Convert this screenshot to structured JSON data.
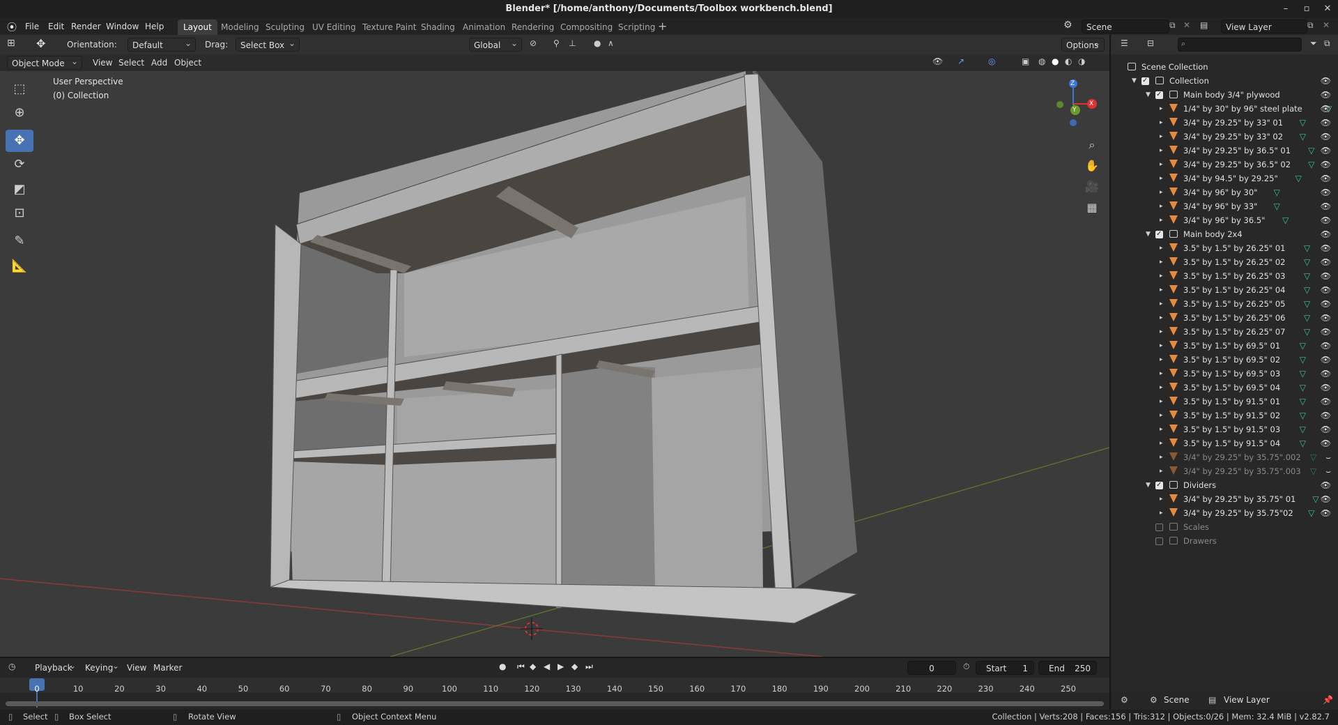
{
  "window": {
    "title": "Blender* [/home/anthony/Documents/Toolbox workbench.blend]",
    "controls": [
      "–",
      "▫",
      "✕"
    ]
  },
  "menu": [
    "File",
    "Edit",
    "Render",
    "Window",
    "Help"
  ],
  "workspaces": [
    "Layout",
    "Modeling",
    "Sculpting",
    "UV Editing",
    "Texture Paint",
    "Shading",
    "Animation",
    "Rendering",
    "Compositing",
    "Scripting"
  ],
  "active_workspace": "Layout",
  "scene_field": "Scene",
  "view_layer_field": "View Layer",
  "tool_header": {
    "orientation_label": "Orientation:",
    "orientation_value": "Default",
    "drag_label": "Drag:",
    "drag_value": "Select Box",
    "transform_orientation": "Global",
    "options": "Options"
  },
  "viewport_header": {
    "mode": "Object Mode",
    "menus": [
      "View",
      "Select",
      "Add",
      "Object"
    ]
  },
  "viewport_overlay_text": {
    "perspective": "User Perspective",
    "collection": "(0) Collection"
  },
  "gizmo": {
    "x": "X",
    "y": "Y",
    "z": "Z"
  },
  "outliner": {
    "root": "Scene Collection",
    "collection": "Collection",
    "groups": [
      {
        "name": "Main body 3/4\" plywood",
        "items": [
          "1/4\" by 30\" by 96\" steel plate",
          "3/4\" by 29.25\" by 33\" 01",
          "3/4\" by 29.25\" by 33\" 02",
          "3/4\" by 29.25\" by 36.5\" 01",
          "3/4\" by 29.25\" by 36.5\" 02",
          "3/4\" by 94.5\" by 29.25\"",
          "3/4\" by 96\" by 30\"",
          "3/4\" by 96\" by 33\"",
          "3/4\" by 96\" by 36.5\""
        ]
      },
      {
        "name": "Main body 2x4",
        "items": [
          "3.5\" by 1.5\" by 26.25\" 01",
          "3.5\" by 1.5\" by 26.25\" 02",
          "3.5\" by 1.5\" by 26.25\" 03",
          "3.5\" by 1.5\" by 26.25\" 04",
          "3.5\" by 1.5\" by 26.25\" 05",
          "3.5\" by 1.5\" by 26.25\" 06",
          "3.5\" by 1.5\" by 26.25\" 07",
          "3.5\" by 1.5\" by 69.5\" 01",
          "3.5\" by 1.5\" by 69.5\" 02",
          "3.5\" by 1.5\" by 69.5\" 03",
          "3.5\" by 1.5\" by 69.5\" 04",
          "3.5\" by 1.5\" by 91.5\" 01",
          "3.5\" by 1.5\" by 91.5\" 02",
          "3.5\" by 1.5\" by 91.5\" 03",
          "3.5\" by 1.5\" by 91.5\" 04"
        ],
        "hidden_items": [
          "3/4\" by 29.25\" by 35.75\".002",
          "3/4\" by 29.25\" by 35.75\".003"
        ]
      },
      {
        "name": "Dividers",
        "items": [
          "3/4\" by 29.25\" by 35.75\" 01",
          "3/4\" by 29.25\" by 35.75\"02"
        ]
      }
    ],
    "excluded": [
      "Scales",
      "Drawers"
    ]
  },
  "timeline": {
    "menus": [
      "Playback",
      "Keying",
      "View",
      "Marker"
    ],
    "current_frame": "0",
    "start_label": "Start",
    "start_value": "1",
    "end_label": "End",
    "end_value": "250",
    "ruler": [
      "0",
      "10",
      "20",
      "30",
      "40",
      "50",
      "60",
      "70",
      "80",
      "90",
      "100",
      "110",
      "120",
      "130",
      "140",
      "150",
      "160",
      "170",
      "180",
      "190",
      "200",
      "210",
      "220",
      "230",
      "240",
      "250"
    ]
  },
  "bottom_right": {
    "scene": "Scene",
    "view_layer": "View Layer"
  },
  "status": {
    "select": "Select",
    "box_select": "Box Select",
    "rotate_view": "Rotate View",
    "context_menu": "Object Context Menu",
    "stats": "Collection | Verts:208 | Faces:156 | Tris:312 | Objects:0/26 | Mem: 32.4 MiB | v2.82.7"
  },
  "colors": {
    "accent": "#4772b3",
    "mesh_icon": "#e88a3c",
    "data_icon": "#39c88a"
  }
}
